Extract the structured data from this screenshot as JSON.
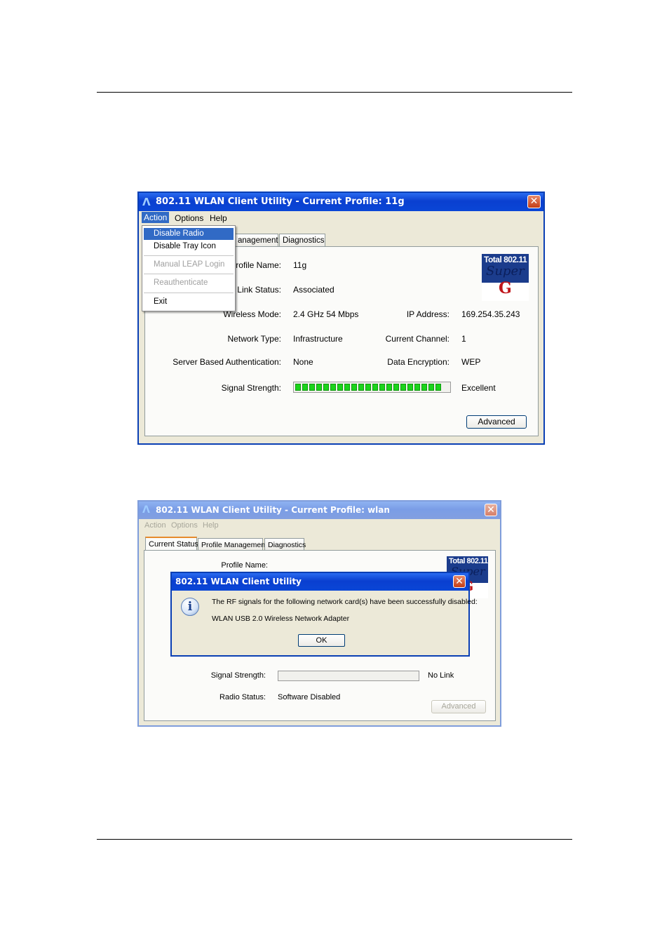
{
  "window1": {
    "title": "802.11 WLAN Client Utility - Current Profile: 11g",
    "menu": [
      "Action",
      "Options",
      "Help"
    ],
    "tabs": [
      "anagement",
      "Diagnostics"
    ],
    "dropdown": {
      "items": [
        {
          "label": "Disable Radio",
          "state": "highlighted"
        },
        {
          "label": "Disable Tray Icon",
          "state": "normal"
        },
        {
          "label": "Manual LEAP Login",
          "state": "disabled"
        },
        {
          "label": "Reauthenticate",
          "state": "disabled"
        },
        {
          "label": "Exit",
          "state": "normal"
        }
      ]
    },
    "badge": {
      "line1": "Total 802.11",
      "line2": "Super",
      "line3": "G"
    },
    "fields": {
      "profile_name_label": "Profile Name:",
      "profile_name": "11g",
      "link_status_label": "Link Status:",
      "link_status": "Associated",
      "wireless_mode_label": "Wireless Mode:",
      "wireless_mode": "2.4 GHz 54 Mbps",
      "ip_address_label": "IP Address:",
      "ip_address": "169.254.35.243",
      "network_type_label": "Network Type:",
      "network_type": "Infrastructure",
      "current_channel_label": "Current Channel:",
      "current_channel": "1",
      "server_auth_label": "Server Based Authentication:",
      "server_auth": "None",
      "data_encryption_label": "Data Encryption:",
      "data_encryption": "WEP",
      "signal_strength_label": "Signal Strength:",
      "signal_strength": "Excellent"
    },
    "signal_level": 1.0,
    "advanced_label": "Advanced"
  },
  "window2": {
    "title": "802.11 WLAN Client Utility - Current Profile: wlan",
    "menu": [
      "Action",
      "Options",
      "Help"
    ],
    "tabs": [
      "Current Status",
      "Profile Management",
      "Diagnostics"
    ],
    "badge": {
      "line1": "Total 802.11",
      "line2": "Super",
      "line3": "G"
    },
    "fields": {
      "profile_name_label": "Profile Name:",
      "signal_strength_label": "Signal Strength:",
      "signal_strength": "No Link",
      "radio_status_label": "Radio Status:",
      "radio_status": "Software Disabled"
    },
    "signal_level": 0,
    "advanced_label": "Advanced"
  },
  "dialog": {
    "title": "802.11 WLAN Client Utility",
    "message": "The RF signals for the following network card(s) have been successfully disabled:",
    "adapter": "WLAN USB 2.0 Wireless Network Adapter",
    "ok_label": "OK",
    "icon": "info-icon"
  },
  "colors": {
    "titlebar": "#0a3fd0",
    "highlight": "#316ac5",
    "signal": "#1bd41b",
    "close": "#c43d16"
  }
}
